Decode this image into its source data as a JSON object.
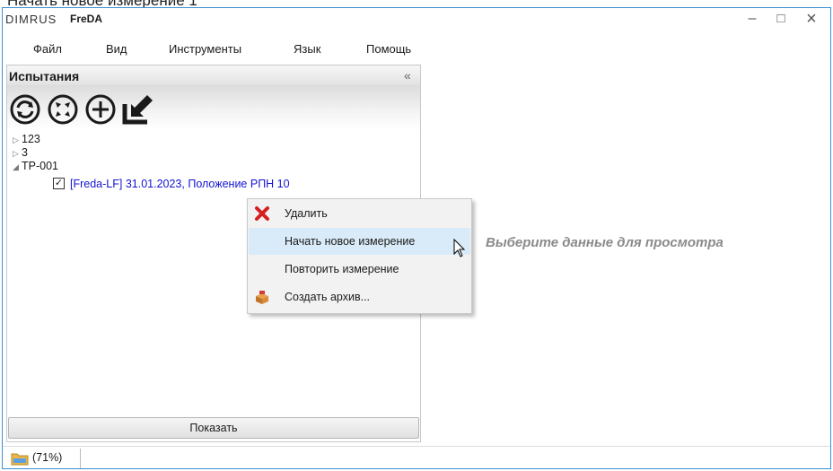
{
  "caption": "Начать новое измерение 1",
  "app": {
    "logo": "DIMRUS",
    "name": "FreDA"
  },
  "window_controls": {
    "minimize": "–",
    "maximize": "□",
    "close": "×"
  },
  "menu": [
    "Файл",
    "Вид",
    "Инструменты",
    "Язык",
    "Помощь"
  ],
  "panel": {
    "title": "Испытания",
    "collapse_glyph": "«",
    "toolbar_icons": [
      "refresh-icon",
      "expand-all-icon",
      "add-icon",
      "import-icon"
    ]
  },
  "tree": {
    "items": [
      {
        "label": "123",
        "expanded": false
      },
      {
        "label": "3",
        "expanded": false
      },
      {
        "label": "TP-001",
        "expanded": true
      }
    ],
    "measurement": {
      "checked": true,
      "label": "[Freda-LF] 31.01.2023, Положение РПН 10"
    }
  },
  "context_menu": {
    "items": [
      {
        "label": "Удалить",
        "icon": "delete-icon"
      },
      {
        "label": "Начать новое измерение",
        "icon": "",
        "highlighted": true
      },
      {
        "label": "Повторить измерение",
        "icon": ""
      },
      {
        "label": "Создать архив...",
        "icon": "archive-icon"
      }
    ]
  },
  "show_button": "Показать",
  "main": {
    "placeholder": "Выберите данные для просмотра"
  },
  "status": {
    "progress_text": "(71%)",
    "progress": 0.71
  },
  "colors": {
    "window_border": "#3b8fd0",
    "link": "#1414d2",
    "highlight": "#d9ebf9"
  }
}
